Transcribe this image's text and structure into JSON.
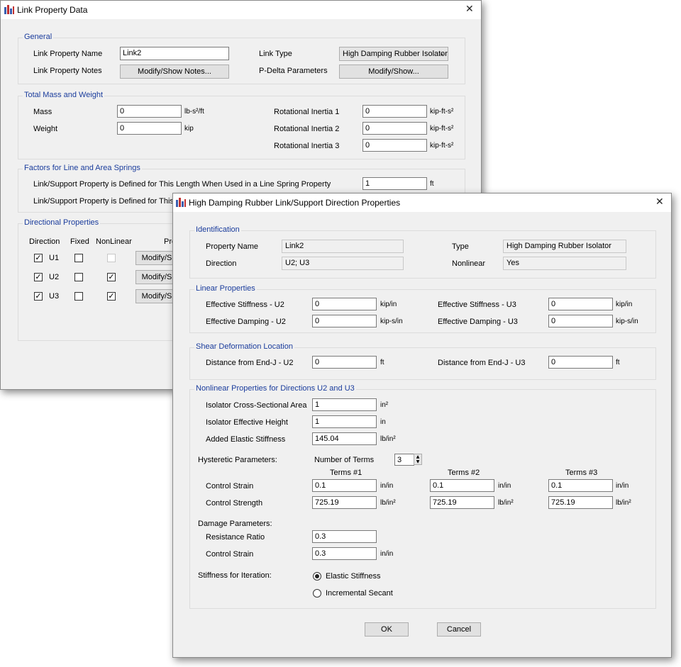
{
  "back_window": {
    "title": "Link Property Data",
    "general": {
      "legend": "General",
      "name_label": "Link Property Name",
      "name_value": "Link2",
      "notes_label": "Link Property Notes",
      "notes_button": "Modify/Show Notes...",
      "type_label": "Link Type",
      "type_value": "High Damping Rubber Isolator",
      "pdelta_label": "P-Delta Parameters",
      "pdelta_button": "Modify/Show..."
    },
    "mass": {
      "legend": "Total Mass and Weight",
      "mass_label": "Mass",
      "mass_value": "0",
      "mass_unit": "lb-s²/ft",
      "weight_label": "Weight",
      "weight_value": "0",
      "weight_unit": "kip",
      "ri1_label": "Rotational Inertia 1",
      "ri1_value": "0",
      "ri2_label": "Rotational Inertia 2",
      "ri2_value": "0",
      "ri3_label": "Rotational Inertia 3",
      "ri3_value": "0",
      "ri_unit": "kip-ft-s²"
    },
    "springs": {
      "legend": "Factors for Line and Area Springs",
      "line_label": "Link/Support Property is Defined for This Length When Used in a Line Spring Property",
      "line_value": "1",
      "line_unit": "ft",
      "area_label": "Link/Support Property is Defined for This Are"
    },
    "directional": {
      "legend": "Directional Properties",
      "col_direction": "Direction",
      "col_fixed": "Fixed",
      "col_nonlinear": "NonLinear",
      "col_properties": "Pro",
      "rows": [
        {
          "dir": "U1",
          "button": "Modify/S"
        },
        {
          "dir": "U2",
          "button": "Modify/S"
        },
        {
          "dir": "U3",
          "button": "Modify/S"
        }
      ]
    }
  },
  "front_window": {
    "title": "High Damping Rubber Link/Support Direction Properties",
    "identification": {
      "legend": "Identification",
      "prop_name_label": "Property Name",
      "prop_name_value": "Link2",
      "direction_label": "Direction",
      "direction_value": "U2; U3",
      "type_label": "Type",
      "type_value": "High Damping Rubber Isolator",
      "nonlinear_label": "Nonlinear",
      "nonlinear_value": "Yes"
    },
    "linear": {
      "legend": "Linear Properties",
      "eff_stiff_u2_label": "Effective Stiffness - U2",
      "eff_stiff_u2_value": "0",
      "eff_stiff_u2_unit": "kip/in",
      "eff_damp_u2_label": "Effective Damping - U2",
      "eff_damp_u2_value": "0",
      "eff_damp_u2_unit": "kip-s/in",
      "eff_stiff_u3_label": "Effective Stiffness - U3",
      "eff_stiff_u3_value": "0",
      "eff_stiff_u3_unit": "kip/in",
      "eff_damp_u3_label": "Effective Damping - U3",
      "eff_damp_u3_value": "0",
      "eff_damp_u3_unit": "kip-s/in"
    },
    "shear": {
      "legend": "Shear Deformation Location",
      "u2_label": "Distance from End-J - U2",
      "u2_value": "0",
      "u2_unit": "ft",
      "u3_label": "Distance from End-J - U3",
      "u3_value": "0",
      "u3_unit": "ft"
    },
    "nonlinear": {
      "legend": "Nonlinear Properties for Directions U2 and U3",
      "area_label": "Isolator Cross-Sectional Area",
      "area_value": "1",
      "area_unit": "in²",
      "height_label": "Isolator Effective Height",
      "height_value": "1",
      "height_unit": "in",
      "added_label": "Added Elastic Stiffness",
      "added_value": "145.04",
      "added_unit": "lb/in²",
      "hysteretic_label": "Hysteretic Parameters:",
      "num_terms_label": "Number of Terms",
      "num_terms_value": "3",
      "terms": [
        {
          "header": "Terms #1",
          "strain": "0.1",
          "strength": "725.19"
        },
        {
          "header": "Terms #2",
          "strain": "0.1",
          "strength": "725.19"
        },
        {
          "header": "Terms #3",
          "strain": "0.1",
          "strength": "725.19"
        }
      ],
      "control_strain_label": "Control Strain",
      "control_strength_label": "Control Strength",
      "strain_unit": "in/in",
      "strength_unit": "lb/in²",
      "damage_label": "Damage Parameters:",
      "resistance_label": "Resistance Ratio",
      "resistance_value": "0.3",
      "damage_strain_label": "Control Strain",
      "damage_strain_value": "0.3",
      "damage_strain_unit": "in/in",
      "stiffness_label": "Stiffness for Iteration:",
      "opt_elastic": "Elastic Stiffness",
      "opt_secant": "Incremental Secant"
    },
    "ok_button": "OK",
    "cancel_button": "Cancel"
  }
}
